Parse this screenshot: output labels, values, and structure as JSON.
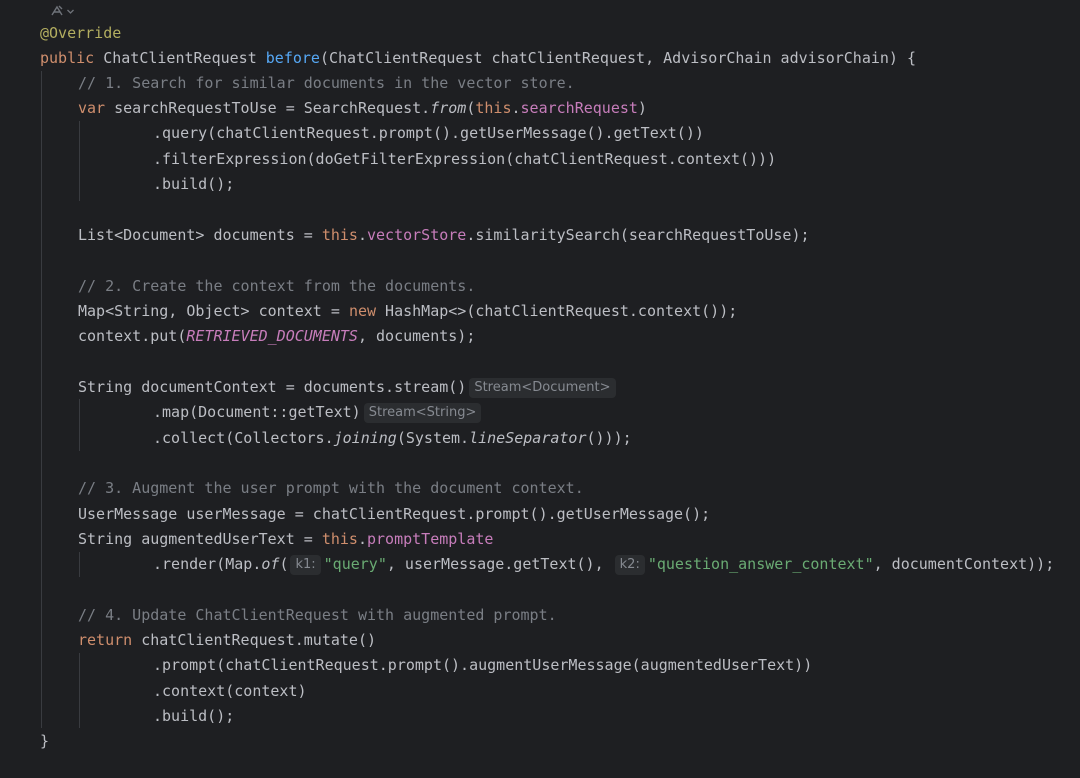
{
  "gutter": {
    "icon": "inlay-settings-icon",
    "chevron": "chevron-down-icon"
  },
  "code": {
    "annotation": "@Override",
    "sig_kw": "public",
    "sig_type": "ChatClientRequest",
    "sig_name": "before",
    "sig_params": "(ChatClientRequest chatClientRequest, AdvisorChain advisorChain) {",
    "c1": "// 1. Search for similar documents in the vector store.",
    "l_var_kw": "var",
    "l_var_a": " searchRequestToUse = SearchRequest.",
    "l_var_from": "from",
    "l_var_b": "(",
    "l_var_this": "this",
    "l_var_c": ".",
    "l_var_field": "searchRequest",
    "l_var_d": ")",
    "query_line": ".query(chatClientRequest.prompt().getUserMessage().getText())",
    "filter_line": ".filterExpression(doGetFilterExpression(chatClientRequest.context()))",
    "build1": ".build();",
    "list_a": "List<Document> documents = ",
    "list_this": "this",
    "list_b": ".",
    "list_field": "vectorStore",
    "list_c": ".similaritySearch(searchRequestToUse);",
    "c2": "// 2. Create the context from the documents.",
    "map_a": "Map<String, Object> context = ",
    "map_new": "new",
    "map_b": " HashMap<>(chatClientRequest.context());",
    "put_a": "context.put(",
    "put_const": "RETRIEVED_DOCUMENTS",
    "put_b": ", documents);",
    "str_a": "String documentContext = documents.stream()",
    "str_hint": "Stream<Document>",
    "map2": ".map(Document::getText)",
    "map2_hint": "Stream<String>",
    "collect_a": ".collect(Collectors.",
    "collect_join": "joining",
    "collect_b": "(System.",
    "collect_sep": "lineSeparator",
    "collect_c": "()));",
    "c3": "// 3. Augment the user prompt with the document context.",
    "um": "UserMessage userMessage = chatClientRequest.prompt().getUserMessage();",
    "aug_a": "String augmentedUserText = ",
    "aug_this": "this",
    "aug_b": ".",
    "aug_field": "promptTemplate",
    "render_a": ".render(Map.",
    "render_of": "of",
    "render_b": "(",
    "k1_hint": "k1:",
    "k1_val": "\"query\"",
    "render_c": ", userMessage.getText(), ",
    "k2_hint": "k2:",
    "k2_val": "\"question_answer_context\"",
    "render_d": ", documentContext));",
    "c4": "// 4. Update ChatClientRequest with augmented prompt.",
    "ret_kw": "return",
    "ret_b": " chatClientRequest.mutate()",
    "prompt_line": ".prompt(chatClientRequest.prompt().augmentUserMessage(augmentedUserText))",
    "context_line": ".context(context)",
    "build2": ".build();",
    "close": "}"
  }
}
